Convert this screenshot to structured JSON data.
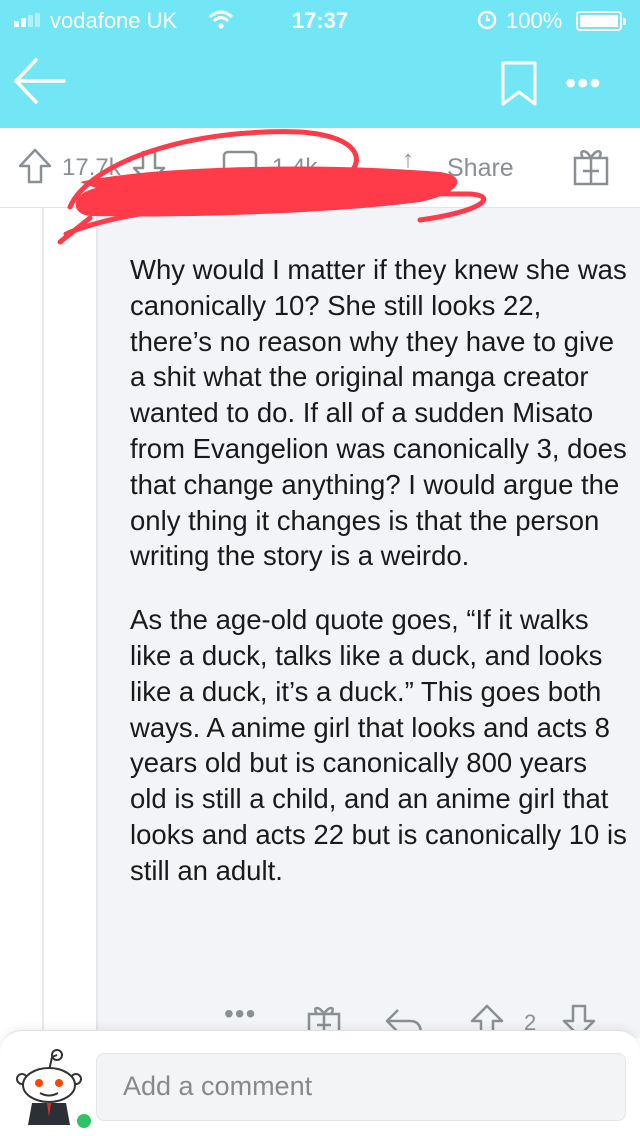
{
  "status_bar": {
    "carrier": "vodafone UK",
    "time": "17:37",
    "battery": "100%"
  },
  "header": {
    "back_icon": "back-arrow-icon",
    "bookmark_icon": "bookmark-icon",
    "more_icon": "more-dots-icon",
    "more_label": "•••"
  },
  "post_actions": {
    "score": "17.7k",
    "comments": "1.4k",
    "share_label": "Share",
    "share_arrow": "↑",
    "gift_icon": "gift-icon"
  },
  "comment": {
    "meta": "· ···",
    "paragraphs": [
      "Why would I matter if they knew she was canonically 10? She still looks 22, there’s no reason why they have to give a shit what the original manga creator wanted to do. If all of a sudden Misato from Evangelion was canonically 3, does that change anything? I would argue the only thing it changes is that the person writing the story is a weirdo.",
      "As the age-old quote goes, “If it walks like a duck, talks like a duck, and looks like a duck, it’s a duck.” This goes both ways. A anime girl that looks and acts 8 years old but is canonically 800 years old is still a child, and an anime girl that looks and acts 22 but is canonically 10 is still an adult."
    ],
    "actions": {
      "more_label": "•••",
      "vote_count": "2"
    }
  },
  "compose": {
    "placeholder": "Add a comment"
  },
  "colors": {
    "header_bg": "#73e6f5",
    "scribble": "#ff3b4a",
    "online": "#2ec463"
  }
}
